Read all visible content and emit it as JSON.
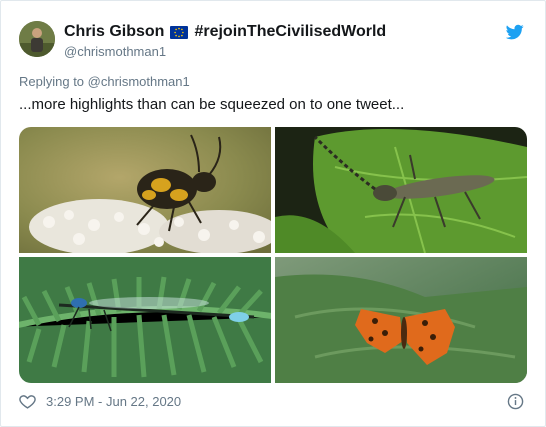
{
  "author": {
    "name": "Chris Gibson",
    "flag_icon": "eu-flag-icon",
    "hashtag": "#rejoinTheCivilisedWorld",
    "handle": "@chrismothman1"
  },
  "reply": {
    "prefix": "Replying to",
    "mention": "@chrismothman1"
  },
  "tweet": {
    "text": "...more highlights than can be squeezed on to one tweet...",
    "photos": [
      {
        "subject": "longhorn beetle on white flowers"
      },
      {
        "subject": "grey longhorn beetle on green leaf"
      },
      {
        "subject": "blue damselfly on fern"
      },
      {
        "subject": "comma butterfly on leaf"
      }
    ]
  },
  "footer": {
    "timestamp": "3:29 PM - Jun 22, 2020",
    "like_icon": "heart-icon",
    "info_icon": "info-icon"
  },
  "colors": {
    "twitter_blue": "#1da1f2",
    "secondary_text": "#657786",
    "primary_text": "#14171a"
  }
}
